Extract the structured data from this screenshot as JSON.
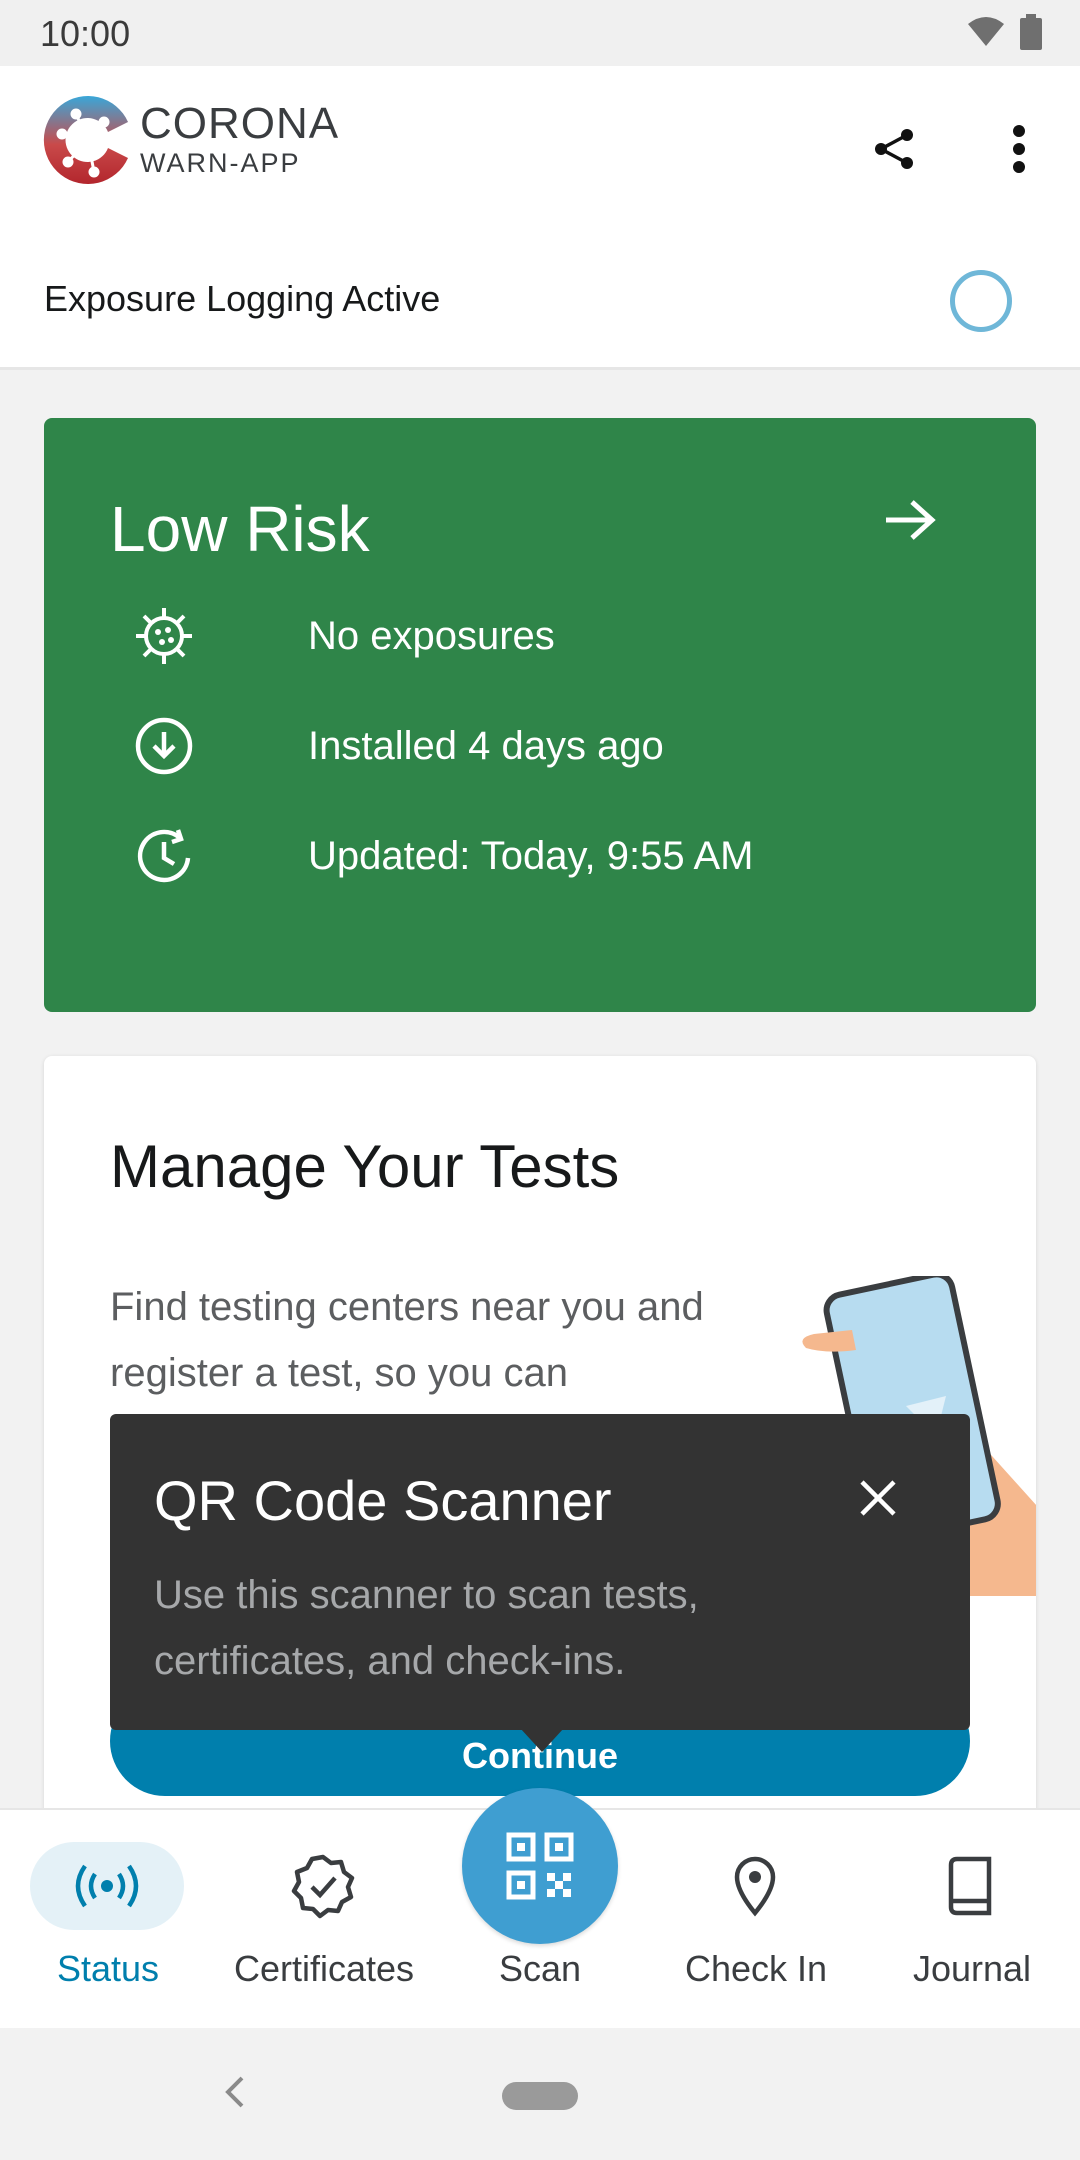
{
  "status_bar": {
    "time": "10:00",
    "icons": [
      "wifi-icon",
      "battery-icon"
    ]
  },
  "app_bar": {
    "brand_line1": "CORONA",
    "brand_line2": "WARN-APP",
    "actions": [
      "share-icon",
      "more-vert-icon"
    ]
  },
  "exposure_logging": {
    "label": "Exposure Logging Active",
    "status_icon": "ring-icon"
  },
  "risk_card": {
    "title": "Low Risk",
    "color": "#2f8549",
    "rows": [
      {
        "icon": "virus-icon",
        "text": "No exposures"
      },
      {
        "icon": "download-icon",
        "text": "Installed 4 days ago"
      },
      {
        "icon": "clock-icon",
        "text": "Updated: Today, 9:55 AM"
      }
    ]
  },
  "tests_card": {
    "title": "Manage Your Tests",
    "description": "Find testing centers near you and register a test, so you can",
    "button_label": "Continue"
  },
  "tooltip": {
    "title": "QR Code Scanner",
    "body": "Use this scanner to scan tests, certificates, and check-ins."
  },
  "bottom_nav": {
    "items": [
      {
        "label": "Status",
        "icon": "broadcast-icon",
        "active": true
      },
      {
        "label": "Certificates",
        "icon": "badge-check-icon",
        "active": false
      },
      {
        "label": "Scan",
        "icon": "qr-code-icon",
        "active": false
      },
      {
        "label": "Check In",
        "icon": "location-pin-icon",
        "active": false
      },
      {
        "label": "Journal",
        "icon": "book-icon",
        "active": false
      }
    ],
    "accent": "#007fad"
  }
}
